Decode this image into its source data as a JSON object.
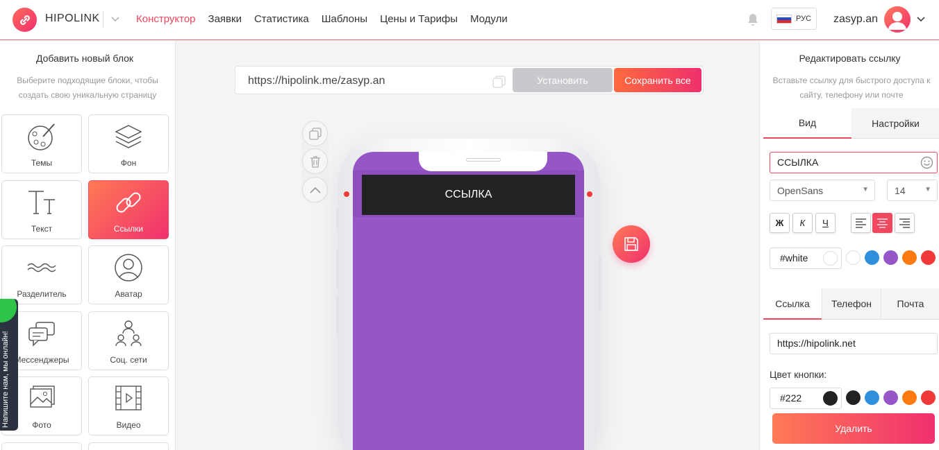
{
  "header": {
    "logo_text": "HIPOLINK",
    "nav": [
      "Конструктор",
      "Заявки",
      "Статистика",
      "Шаблоны",
      "Цены и Тарифы",
      "Модули"
    ],
    "lang": "РУС",
    "username": "zasyp.an"
  },
  "left": {
    "title": "Добавить новый блок",
    "subtitle": "Выберите подходящие блоки, чтобы создать свою уникальную страницу",
    "tiles": [
      "Темы",
      "Фон",
      "Текст",
      "Ссылки",
      "Разделитель",
      "Аватар",
      "Мессенджеры",
      "Соц. сети",
      "Фото",
      "Видео"
    ],
    "chat": "Напишите нам, мы онлайн!"
  },
  "center": {
    "url": "https://hipolink.me/zasyp.an",
    "install_label": "Установить",
    "save_all_label": "Сохранить все",
    "link_block_text": "ССЫЛКА"
  },
  "right": {
    "title": "Редактировать ссылку",
    "subtitle": "Вставьте ссылку для быстрого доступа к сайту, телефону или почте",
    "tabs": [
      "Вид",
      "Настройки"
    ],
    "text_value": "ССЫЛКА",
    "font": "OpenSans",
    "size": "14",
    "format": [
      "Ж",
      "К",
      "Ч"
    ],
    "text_color": "#white",
    "link_tabs": [
      "Ссылка",
      "Телефон",
      "Почта"
    ],
    "link_value": "https://hipolink.net",
    "button_color_label": "Цвет кнопки:",
    "button_color": "#222",
    "delete_label": "Удалить"
  },
  "palette": [
    "#ffffff",
    "#2e8fdc",
    "#9656c8",
    "#ff7b12",
    "#f03a3a"
  ],
  "palette_dark": [
    "#222222",
    "#2e8fdc",
    "#9656c8",
    "#ff7b12",
    "#f03a3a"
  ],
  "accent": "#f0485f",
  "screen_bg": "#9656c8"
}
